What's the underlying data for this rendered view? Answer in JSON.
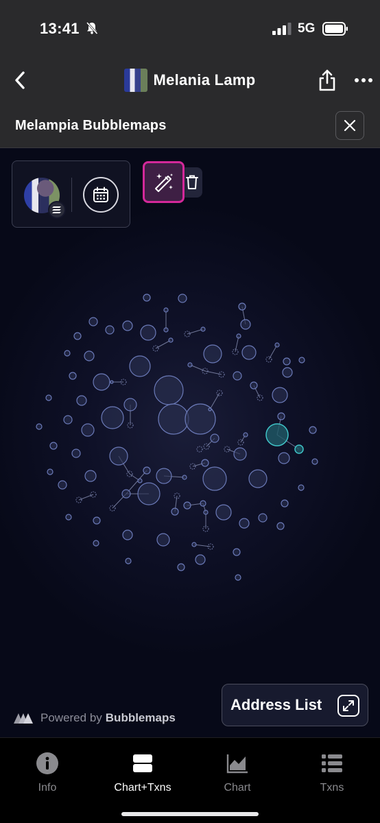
{
  "status_bar": {
    "time": "13:41",
    "network": "5G",
    "icons": [
      "bell-slash-icon",
      "signal-icon",
      "battery-icon"
    ]
  },
  "header": {
    "title": "Melania Lamp",
    "icons": [
      "back-chevron-icon",
      "share-icon",
      "more-icon"
    ]
  },
  "sub_header": {
    "title": "Melampia Bubblemaps",
    "icons": [
      "close-icon"
    ]
  },
  "map": {
    "toolbar_icons": [
      "token-avatar",
      "solana-badge-icon",
      "calendar-icon",
      "magic-wand-icon",
      "trash-icon"
    ],
    "powered_prefix": "Powered by",
    "powered_brand": "Bubblemaps",
    "address_list_label": "Address List",
    "colors": {
      "bubble_fill": "#2a3050",
      "bubble_stroke": "#6b7ab8",
      "highlight": "#3fc3c7",
      "accent": "#d4289a"
    }
  },
  "tabs": [
    {
      "label": "Info",
      "icon": "info-icon",
      "active": false
    },
    {
      "label": "Chart+Txns",
      "icon": "split-view-icon",
      "active": true
    },
    {
      "label": "Chart",
      "icon": "area-chart-icon",
      "active": false
    },
    {
      "label": "Txns",
      "icon": "list-icon",
      "active": false
    }
  ]
}
